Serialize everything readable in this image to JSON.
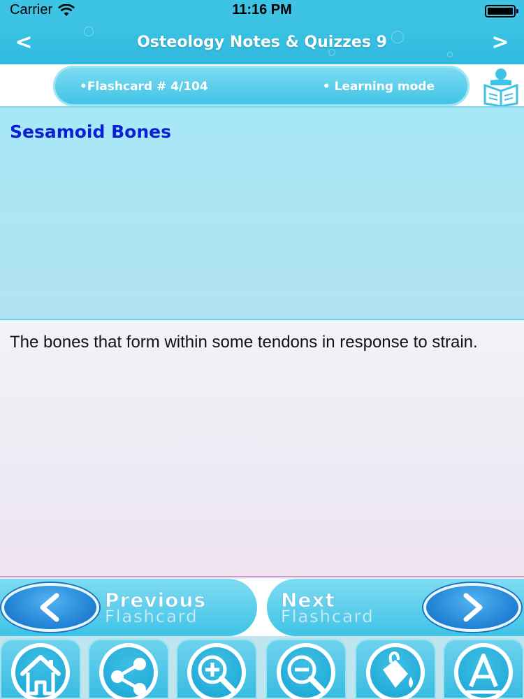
{
  "status_bar": {
    "carrier": "Carrier",
    "time": "11:16 PM",
    "battery_level": 1.0
  },
  "nav": {
    "title": "Osteology Notes & Quizzes 9",
    "back_glyph": "<",
    "forward_glyph": ">"
  },
  "info": {
    "flashcard_label": "•Flashcard #  4/104",
    "mode_label": "• Learning mode"
  },
  "card": {
    "question": "Sesamoid Bones",
    "answer": "The bones that form within some tendons in response to strain."
  },
  "navigation": {
    "previous_line1": "Previous",
    "previous_line2": "Flashcard",
    "next_line1": "Next",
    "next_line2": "Flashcard"
  },
  "toolbar_icons": [
    "home-icon",
    "share-icon",
    "zoom-in-icon",
    "zoom-out-icon",
    "paint-bucket-icon",
    "font-icon"
  ],
  "colors": {
    "accent": "#3dc4e4",
    "question_text": "#0b1fd6",
    "arrow_button": "#1f7fd4"
  }
}
